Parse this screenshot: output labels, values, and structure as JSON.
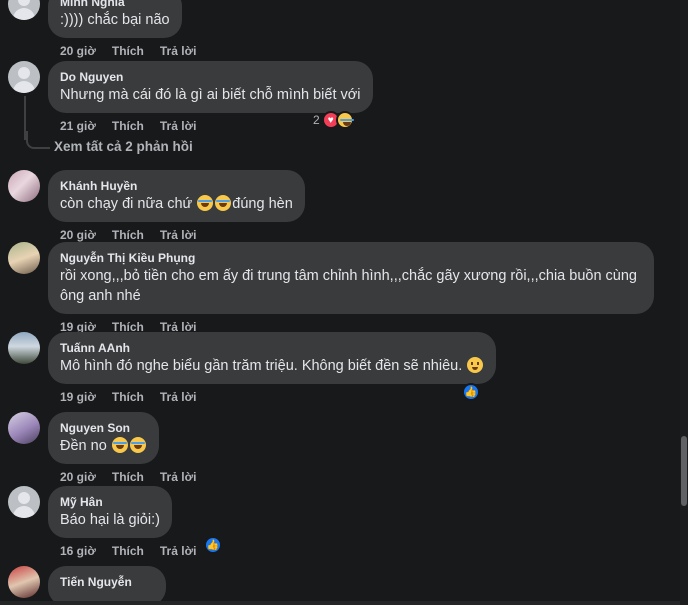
{
  "comments": [
    {
      "author": "Minh Nghĩa",
      "text": ":)))) chắc bại não",
      "time": "20 giờ",
      "like": "Thích",
      "reply": "Trả lời"
    },
    {
      "author": "Do Nguyen",
      "text": "Nhưng mà cái đó là gì ai biết chỗ mình biết với",
      "time": "21 giờ",
      "like": "Thích",
      "reply": "Trả lời",
      "reaction_count": "2"
    },
    {
      "author": "Khánh Huyền",
      "text_before": "còn chạy đi nữa chứ ",
      "text_after": "đúng hèn",
      "time": "20 giờ",
      "like": "Thích",
      "reply": "Trả lời"
    },
    {
      "author": "Nguyễn Thị Kiều Phụng",
      "text": "rồi xong,,,bỏ tiền cho em ấy đi trung tâm chỉnh hình,,,chắc gãy xương rồi,,,chia buồn cùng ông anh nhé",
      "time": "19 giờ",
      "like": "Thích",
      "reply": "Trả lời"
    },
    {
      "author": "Tuấnn AAnh",
      "text": "Mô hình đó nghe biểu gần trăm triệu. Không biết đền sẽ nhiêu. ",
      "time": "19 giờ",
      "like": "Thích",
      "reply": "Trả lời"
    },
    {
      "author": "Nguyen Son",
      "text": "Đền no ",
      "time": "20 giờ",
      "like": "Thích",
      "reply": "Trả lời"
    },
    {
      "author": "Mỹ Hân",
      "text": "Báo hại là giỏi:)",
      "time": "16 giờ",
      "like": "Thích",
      "reply": "Trả lời"
    },
    {
      "author": "Tiến Nguyễn"
    }
  ],
  "view_replies": "Xem tất cả 2 phản hồi",
  "colors": {
    "background": "#18191a",
    "bubble": "#3a3b3c",
    "muted": "#b0b3b8",
    "like_blue": "#1877f2",
    "heart": "#f33e58"
  },
  "icons": {
    "like_reaction": "like-icon",
    "heart_reaction": "heart-icon",
    "haha_reaction": "haha-icon"
  }
}
